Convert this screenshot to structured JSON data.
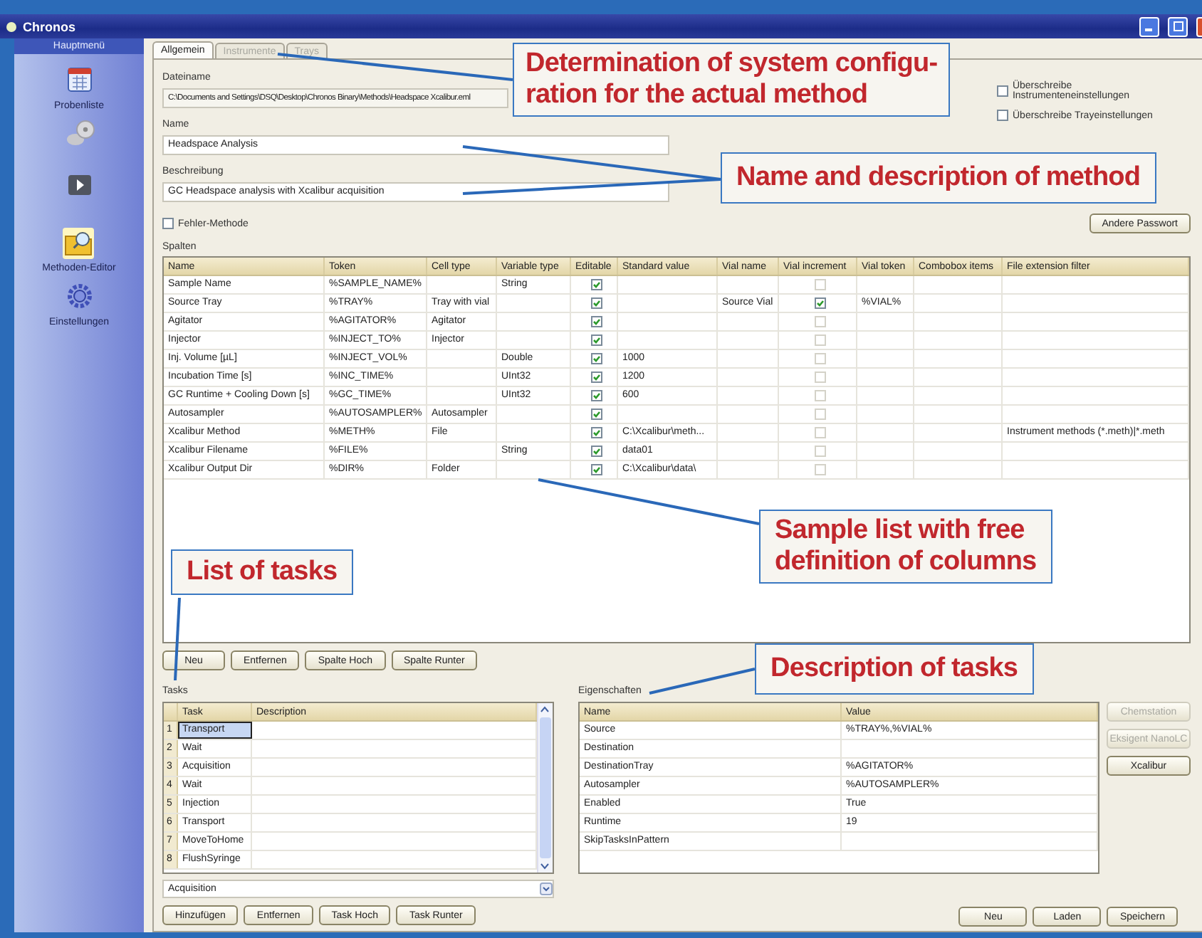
{
  "window": {
    "title": "Chronos"
  },
  "sidebar": {
    "header": "Hauptmenü",
    "items": [
      {
        "kind": "calendar",
        "label": "Probenliste",
        "selected": false
      },
      {
        "kind": "disc",
        "selected": false
      },
      {
        "kind": "play",
        "selected": false
      },
      {
        "kind": "folder",
        "label": "Methoden-Editor",
        "selected": true
      },
      {
        "kind": "gear",
        "label": "Einstellungen",
        "selected": false
      }
    ]
  },
  "tabs": [
    {
      "label": "Allgemein",
      "selected": true,
      "disabled": false
    },
    {
      "label": "Instrumente",
      "selected": false,
      "disabled": true
    },
    {
      "label": "Trays",
      "selected": false,
      "disabled": true
    }
  ],
  "fields": [
    {
      "label": "Dateiname",
      "value": "C:\\Documents and Settings\\DSQ\\Desktop\\Chronos Binary\\Methods\\Headspace Xcalibur.eml",
      "kind": "readonly"
    },
    {
      "label": "Name",
      "value": "Headspace Analysis",
      "kind": "text"
    },
    {
      "label": "Beschreibung",
      "value": "GC Headspace analysis with Xcalibur acquisition",
      "kind": "text"
    }
  ],
  "error_method": {
    "label": "Fehler-Methode",
    "checked": false
  },
  "overrides": [
    {
      "label": "Überschreibe Instrumenteneinstellungen",
      "checked": false
    },
    {
      "label": "Überschreibe Trayeinstellungen",
      "checked": false
    }
  ],
  "password_button": "Andere Passwort",
  "columns_table": {
    "label": "Spalten",
    "columns": [
      "Name",
      "Token",
      "Cell type",
      "Variable type",
      "Editable",
      "Standard value",
      "Vial name",
      "Vial increment",
      "Vial token",
      "Combobox items",
      "File extension filter"
    ],
    "rows": [
      {
        "name": "Sample Name",
        "token": "%SAMPLE_NAME%",
        "variable_type": "String",
        "editable": true,
        "vial_increment": false
      },
      {
        "name": "Source Tray",
        "token": "%TRAY%",
        "cell_type": "Tray with vial",
        "editable": true,
        "vial_name": "Source Vial",
        "vial_increment": true,
        "vial_token": "%VIAL%"
      },
      {
        "name": "Agitator",
        "token": "%AGITATOR%",
        "cell_type": "Agitator",
        "editable": true,
        "vial_increment": false
      },
      {
        "name": "Injector",
        "token": "%INJECT_TO%",
        "cell_type": "Injector",
        "editable": true,
        "vial_increment": false
      },
      {
        "name": "Inj. Volume [µL]",
        "token": "%INJECT_VOL%",
        "variable_type": "Double",
        "editable": true,
        "standard_value": "1000",
        "vial_increment": false
      },
      {
        "name": "Incubation Time [s]",
        "token": "%INC_TIME%",
        "variable_type": "UInt32",
        "editable": true,
        "standard_value": "1200",
        "vial_increment": false
      },
      {
        "name": "GC Runtime + Cooling Down [s]",
        "token": "%GC_TIME%",
        "variable_type": "UInt32",
        "editable": true,
        "standard_value": "600",
        "vial_increment": false
      },
      {
        "name": "Autosampler",
        "token": "%AUTOSAMPLER%",
        "cell_type": "Autosampler",
        "editable": true,
        "vial_increment": false
      },
      {
        "name": "Xcalibur Method",
        "token": "%METH%",
        "cell_type": "File",
        "editable": true,
        "standard_value": "C:\\Xcalibur\\meth...",
        "vial_increment": false,
        "file_extension_filter": "Instrument methods (*.meth)|*.meth"
      },
      {
        "name": "Xcalibur Filename",
        "token": "%FILE%",
        "variable_type": "String",
        "editable": true,
        "standard_value": "data01",
        "vial_increment": false
      },
      {
        "name": "Xcalibur Output Dir",
        "token": "%DIR%",
        "cell_type": "Folder",
        "editable": true,
        "standard_value": "C:\\Xcalibur\\data\\",
        "vial_increment": false
      }
    ]
  },
  "column_buttons": [
    "Neu",
    "Entfernen",
    "Spalte Hoch",
    "Spalte Runter"
  ],
  "tasks": {
    "label": "Tasks",
    "columns": [
      "Task",
      "Description"
    ],
    "rows": [
      {
        "number": "1",
        "task": "Transport",
        "selected": true
      },
      {
        "number": "2",
        "task": "Wait",
        "selected": false
      },
      {
        "number": "3",
        "task": "Acquisition",
        "selected": false
      },
      {
        "number": "4",
        "task": "Wait",
        "selected": false
      },
      {
        "number": "5",
        "task": "Injection",
        "selected": false
      },
      {
        "number": "6",
        "task": "Transport",
        "selected": false
      },
      {
        "number": "7",
        "task": "MoveToHome",
        "selected": false
      },
      {
        "number": "8",
        "task": "FlushSyringe",
        "selected": false
      }
    ],
    "dropdown": "Acquisition",
    "buttons": [
      "Hinzufügen",
      "Entfernen",
      "Task Hoch",
      "Task Runter"
    ]
  },
  "properties": {
    "label": "Eigenschaften",
    "columns": [
      "Name",
      "Value"
    ],
    "rows": [
      {
        "name": "Source",
        "value": "%TRAY%,%VIAL%"
      },
      {
        "name": "Destination"
      },
      {
        "name": "DestinationTray",
        "value": "%AGITATOR%"
      },
      {
        "name": "Autosampler",
        "value": "%AUTOSAMPLER%"
      },
      {
        "name": "Enabled",
        "value": "True"
      },
      {
        "name": "Runtime",
        "value": "19"
      },
      {
        "name": "SkipTasksInPattern"
      }
    ]
  },
  "instrument_buttons": [
    {
      "label": "Chemstation",
      "disabled": true
    },
    {
      "label": "Eksigent NanoLC",
      "disabled": true
    },
    {
      "label": "Xcalibur",
      "disabled": false
    }
  ],
  "method_buttons": [
    "Neu",
    "Laden",
    "Speichern"
  ],
  "callouts": [
    {
      "text": "Determination of system configu-\nration for the actual method"
    },
    {
      "text": "Name and description of method"
    },
    {
      "text": "Sample list with free\ndefinition of columns"
    },
    {
      "text": "List of tasks"
    },
    {
      "text": "Description of tasks"
    }
  ]
}
